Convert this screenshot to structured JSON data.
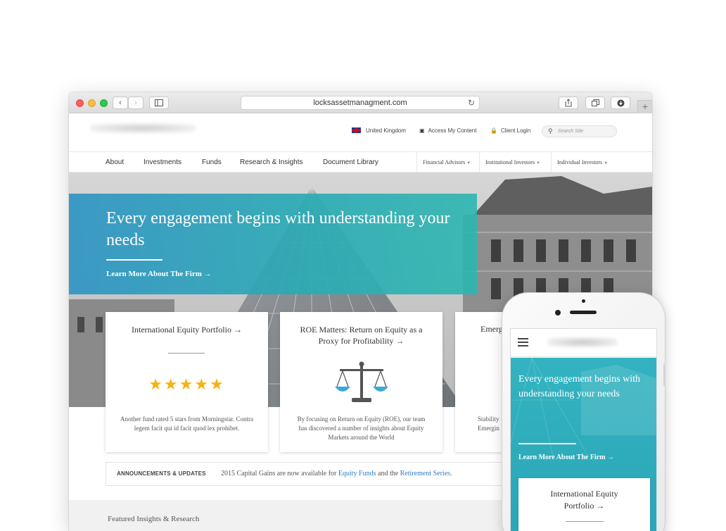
{
  "browser": {
    "url": "locksassetmanagment.com",
    "new_tab": "+"
  },
  "header": {
    "region": "United Kingdom",
    "access": "Access My Content",
    "login": "Client Login",
    "search_placeholder": "Search Site"
  },
  "nav": {
    "items": [
      {
        "label": "About"
      },
      {
        "label": "Investments"
      },
      {
        "label": "Funds"
      },
      {
        "label": "Research & Insights"
      },
      {
        "label": "Document Library"
      }
    ],
    "audiences": [
      {
        "label": "Financial Advisors"
      },
      {
        "label": "Institutional Investors"
      },
      {
        "label": "Individual Investors"
      }
    ]
  },
  "hero": {
    "title": "Every engagement begins with understanding your needs",
    "link": "Learn More About The Firm →",
    "accent": "#2ba4bd"
  },
  "cards": [
    {
      "title": "International Equity Portfolio →",
      "rating": 5,
      "body": "Another fund rated 5 stars from Morningstar. Contra legem facit qui id facit quod lex prohibet."
    },
    {
      "title": "ROE Matters: Return on Equity as a Proxy for Profitability →",
      "icon": "balance-scale-icon",
      "body": "By focusing on Return on Equity (ROE), our team has discovered a number of insights about Equity Markets around the World"
    },
    {
      "title_partial": "Emerg",
      "body_line1": "Stability",
      "body_line2": "Emergin"
    }
  ],
  "announcements": {
    "label": "ANNOUNCEMENTS & UPDATES",
    "text_before": "2015 Capital Gains are now available for ",
    "link1": "Equity Funds",
    "text_mid": " and the ",
    "link2": "Retirement Series",
    "text_after": "."
  },
  "featured": {
    "title": "Featured Insights & Research"
  },
  "mobile": {
    "title": "Every engagement begins with understanding your needs",
    "link": "Learn More About The Firm →",
    "card_title": "International Equity Portfolio →"
  },
  "colors": {
    "star": "#f5b214",
    "link": "#2f7dbf",
    "scale": "#3aa8d9"
  }
}
